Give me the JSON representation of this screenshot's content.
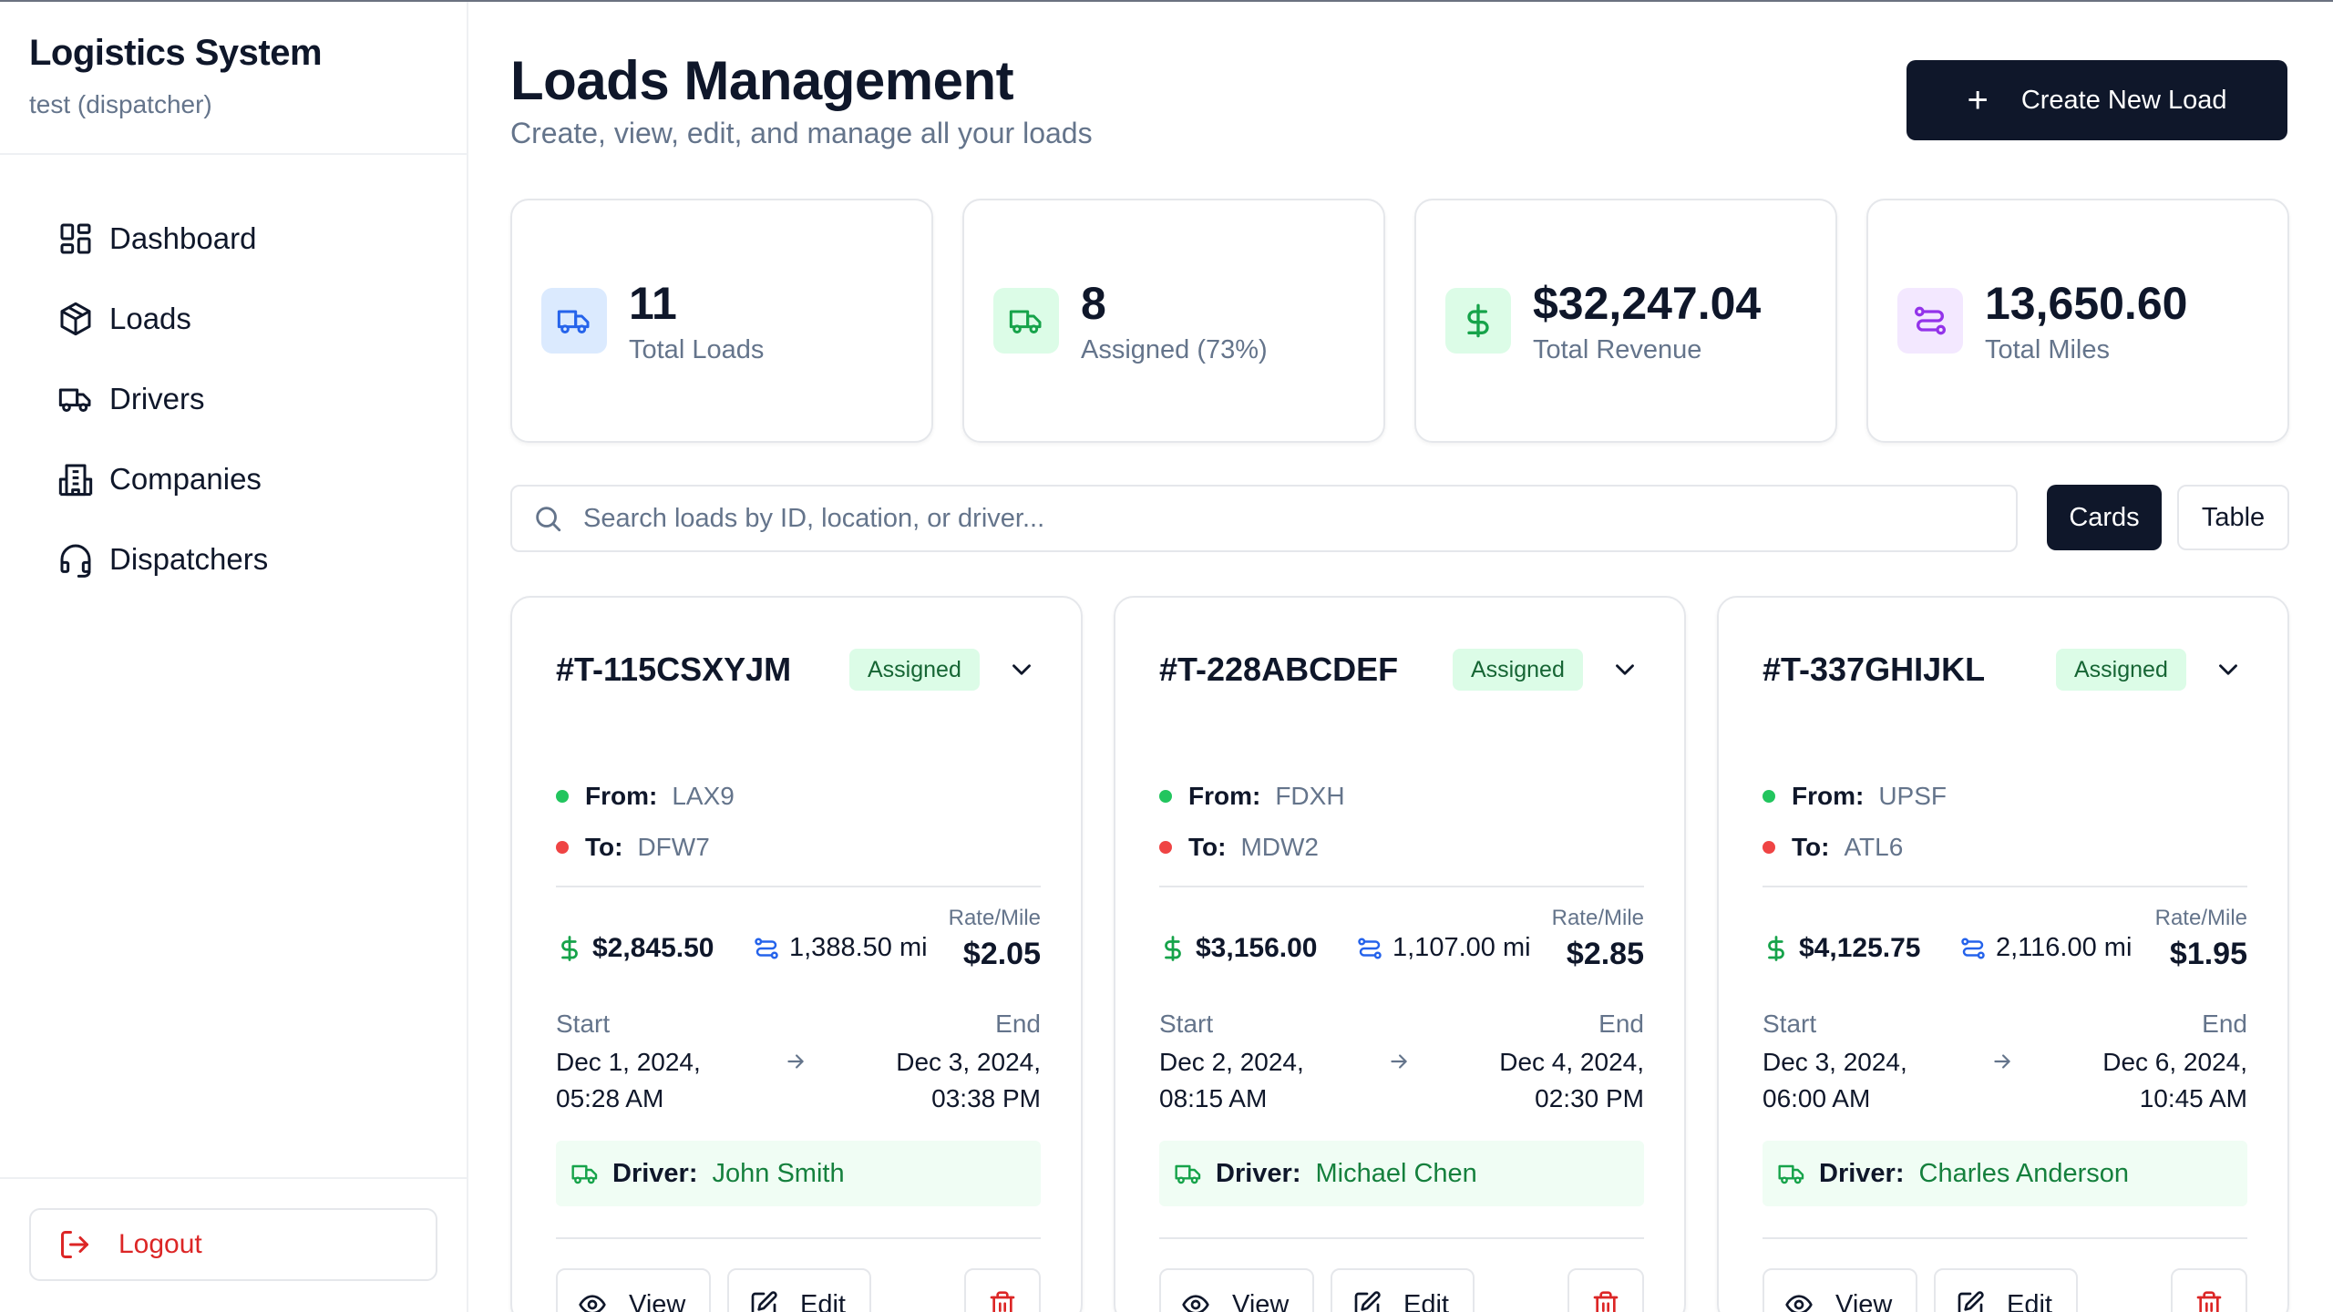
{
  "sidebar": {
    "brand_title": "Logistics System",
    "brand_sub": "test (dispatcher)",
    "items": [
      {
        "label": "Dashboard",
        "icon": "dashboard-icon"
      },
      {
        "label": "Loads",
        "icon": "package-icon"
      },
      {
        "label": "Drivers",
        "icon": "truck-icon"
      },
      {
        "label": "Companies",
        "icon": "building-icon"
      },
      {
        "label": "Dispatchers",
        "icon": "headset-icon"
      }
    ],
    "logout_label": "Logout"
  },
  "header": {
    "title": "Loads Management",
    "subtitle": "Create, view, edit, and manage all your loads",
    "create_label": "Create New Load"
  },
  "stats": [
    {
      "value": "11",
      "label": "Total Loads",
      "icon": "truck-icon",
      "bg": "#dbeafe",
      "color": "#2563eb"
    },
    {
      "value": "8",
      "label": "Assigned (73%)",
      "icon": "truck-icon",
      "bg": "#dcfce7",
      "color": "#16a34a"
    },
    {
      "value": "$32,247.04",
      "label": "Total Revenue",
      "icon": "dollar-icon",
      "bg": "#dcfce7",
      "color": "#16a34a"
    },
    {
      "value": "13,650.60",
      "label": "Total Miles",
      "icon": "route-icon",
      "bg": "#f3e8ff",
      "color": "#9333ea"
    }
  ],
  "search": {
    "placeholder": "Search loads by ID, location, or driver..."
  },
  "view_toggle": {
    "cards_label": "Cards",
    "table_label": "Table"
  },
  "cards": [
    {
      "id": "#T-115CSXYJM",
      "status": "Assigned",
      "from_label": "From:",
      "from": "LAX9",
      "to_label": "To:",
      "to": "DFW7",
      "amount": "$2,845.50",
      "miles": "1,388.50 mi",
      "rate_label": "Rate/Mile",
      "rate": "$2.05",
      "start_label": "Start",
      "start_date": "Dec 1, 2024,",
      "start_time": "05:28 AM",
      "end_label": "End",
      "end_date": "Dec 3, 2024,",
      "end_time": "03:38 PM",
      "driver_label": "Driver:",
      "driver": "John Smith",
      "view_label": "View",
      "edit_label": "Edit"
    },
    {
      "id": "#T-228ABCDEF",
      "status": "Assigned",
      "from_label": "From:",
      "from": "FDXH",
      "to_label": "To:",
      "to": "MDW2",
      "amount": "$3,156.00",
      "miles": "1,107.00 mi",
      "rate_label": "Rate/Mile",
      "rate": "$2.85",
      "start_label": "Start",
      "start_date": "Dec 2, 2024,",
      "start_time": "08:15 AM",
      "end_label": "End",
      "end_date": "Dec 4, 2024,",
      "end_time": "02:30 PM",
      "driver_label": "Driver:",
      "driver": "Michael Chen",
      "view_label": "View",
      "edit_label": "Edit"
    },
    {
      "id": "#T-337GHIJKL",
      "status": "Assigned",
      "from_label": "From:",
      "from": "UPSF",
      "to_label": "To:",
      "to": "ATL6",
      "amount": "$4,125.75",
      "miles": "2,116.00 mi",
      "rate_label": "Rate/Mile",
      "rate": "$1.95",
      "start_label": "Start",
      "start_date": "Dec 3, 2024,",
      "start_time": "06:00 AM",
      "end_label": "End",
      "end_date": "Dec 6, 2024,",
      "end_time": "10:45 AM",
      "driver_label": "Driver:",
      "driver": "Charles Anderson",
      "view_label": "View",
      "edit_label": "Edit"
    }
  ],
  "colors": {
    "primary": "#0f172a",
    "muted": "#64748b",
    "success": "#16a34a",
    "danger": "#dc2626",
    "border": "#e5e7eb"
  }
}
